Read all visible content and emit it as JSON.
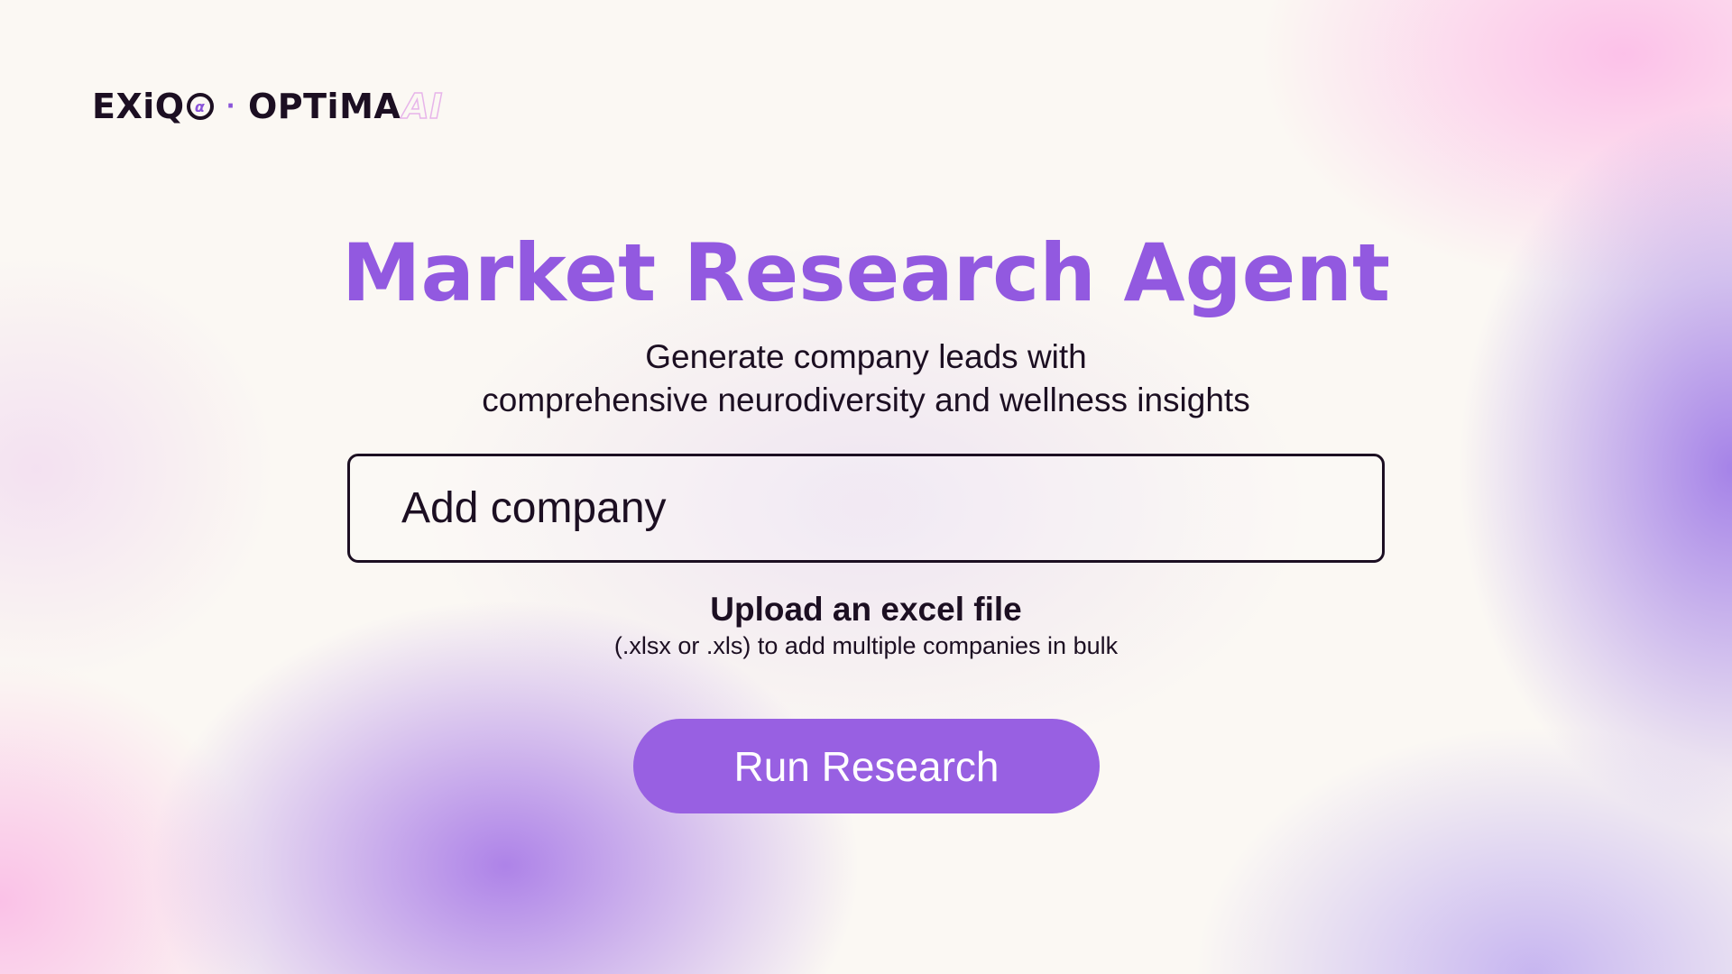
{
  "logo": {
    "brand1_prefix": "EXiQ",
    "brand1_ring_glyph": "α",
    "separator": "·",
    "brand2": "OPTiMA",
    "brand2_suffix": "AI"
  },
  "hero": {
    "title": "Market Research Agent",
    "subtitle_line1": "Generate company leads with",
    "subtitle_line2": "comprehensive neurodiversity and wellness insights"
  },
  "company_input": {
    "placeholder": "Add company",
    "value": ""
  },
  "upload": {
    "title": "Upload an excel file",
    "hint": "(.xlsx or .xls) to add multiple companies in bulk"
  },
  "run_button": {
    "label": "Run Research"
  },
  "colors": {
    "accent": "#9860e2",
    "title": "#9259e0",
    "text": "#1c0f22"
  }
}
